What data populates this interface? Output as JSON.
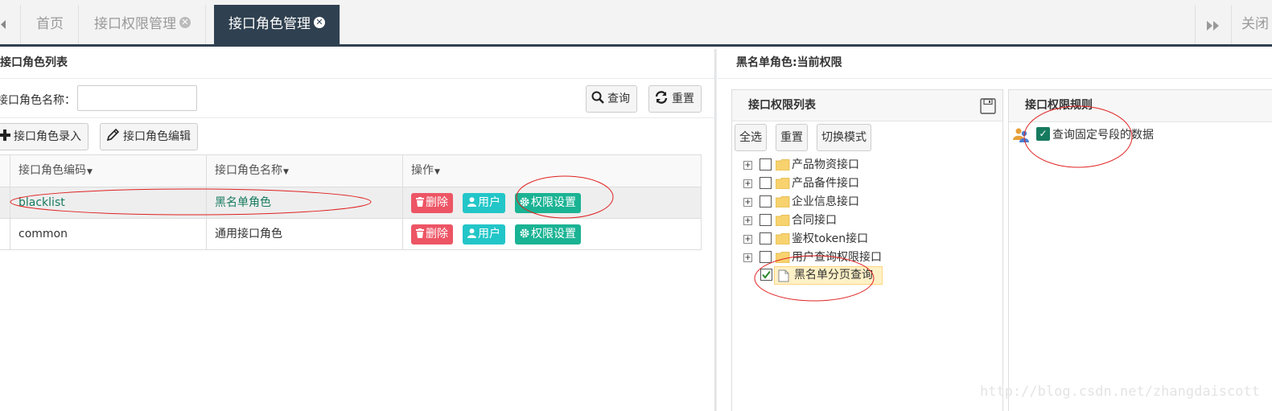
{
  "tabs": {
    "items": [
      {
        "label": "首页"
      },
      {
        "label": "接口权限管理"
      },
      {
        "label": "接口角色管理"
      }
    ],
    "close_label": "关闭"
  },
  "left": {
    "title": "接口角色列表",
    "search_label": "接口角色名称：",
    "search_value": "",
    "query_btn": "查询",
    "reset_btn": "重置",
    "add_btn": "接口角色录入",
    "edit_btn": "接口角色编辑"
  },
  "grid": {
    "columns": [
      "接口角色编码",
      "接口角色名称",
      "操作"
    ],
    "rows": [
      {
        "code": "blacklist",
        "name": "黑名单角色",
        "selected": true
      },
      {
        "code": "common",
        "name": "通用接口角色",
        "selected": false
      }
    ],
    "actions": {
      "delete": "删除",
      "user": "用户",
      "perm": "权限设置"
    }
  },
  "right": {
    "title": "黑名单角色:当前权限",
    "perm_list_title": "接口权限列表",
    "btn_select_all": "全选",
    "btn_reset": "重置",
    "btn_switch": "切换模式",
    "tree": [
      {
        "label": "产品物资接口"
      },
      {
        "label": "产品备件接口"
      },
      {
        "label": "企业信息接口"
      },
      {
        "label": "合同接口"
      },
      {
        "label": "鉴权token接口"
      },
      {
        "label": "用户查询权限接口"
      }
    ],
    "tree_leaf": {
      "label": "黑名单分页查询",
      "checked": true
    },
    "rule_title": "接口权限规则",
    "rule_item": {
      "label": "查询固定号段的数据",
      "checked": true
    }
  },
  "watermark": "http://blog.csdn.net/zhangdaiscott",
  "colors": {
    "dark": "#2f4050",
    "danger": "#ed5565",
    "info": "#23c6c8",
    "primary": "#1ab394",
    "annotation": "#e02020"
  }
}
